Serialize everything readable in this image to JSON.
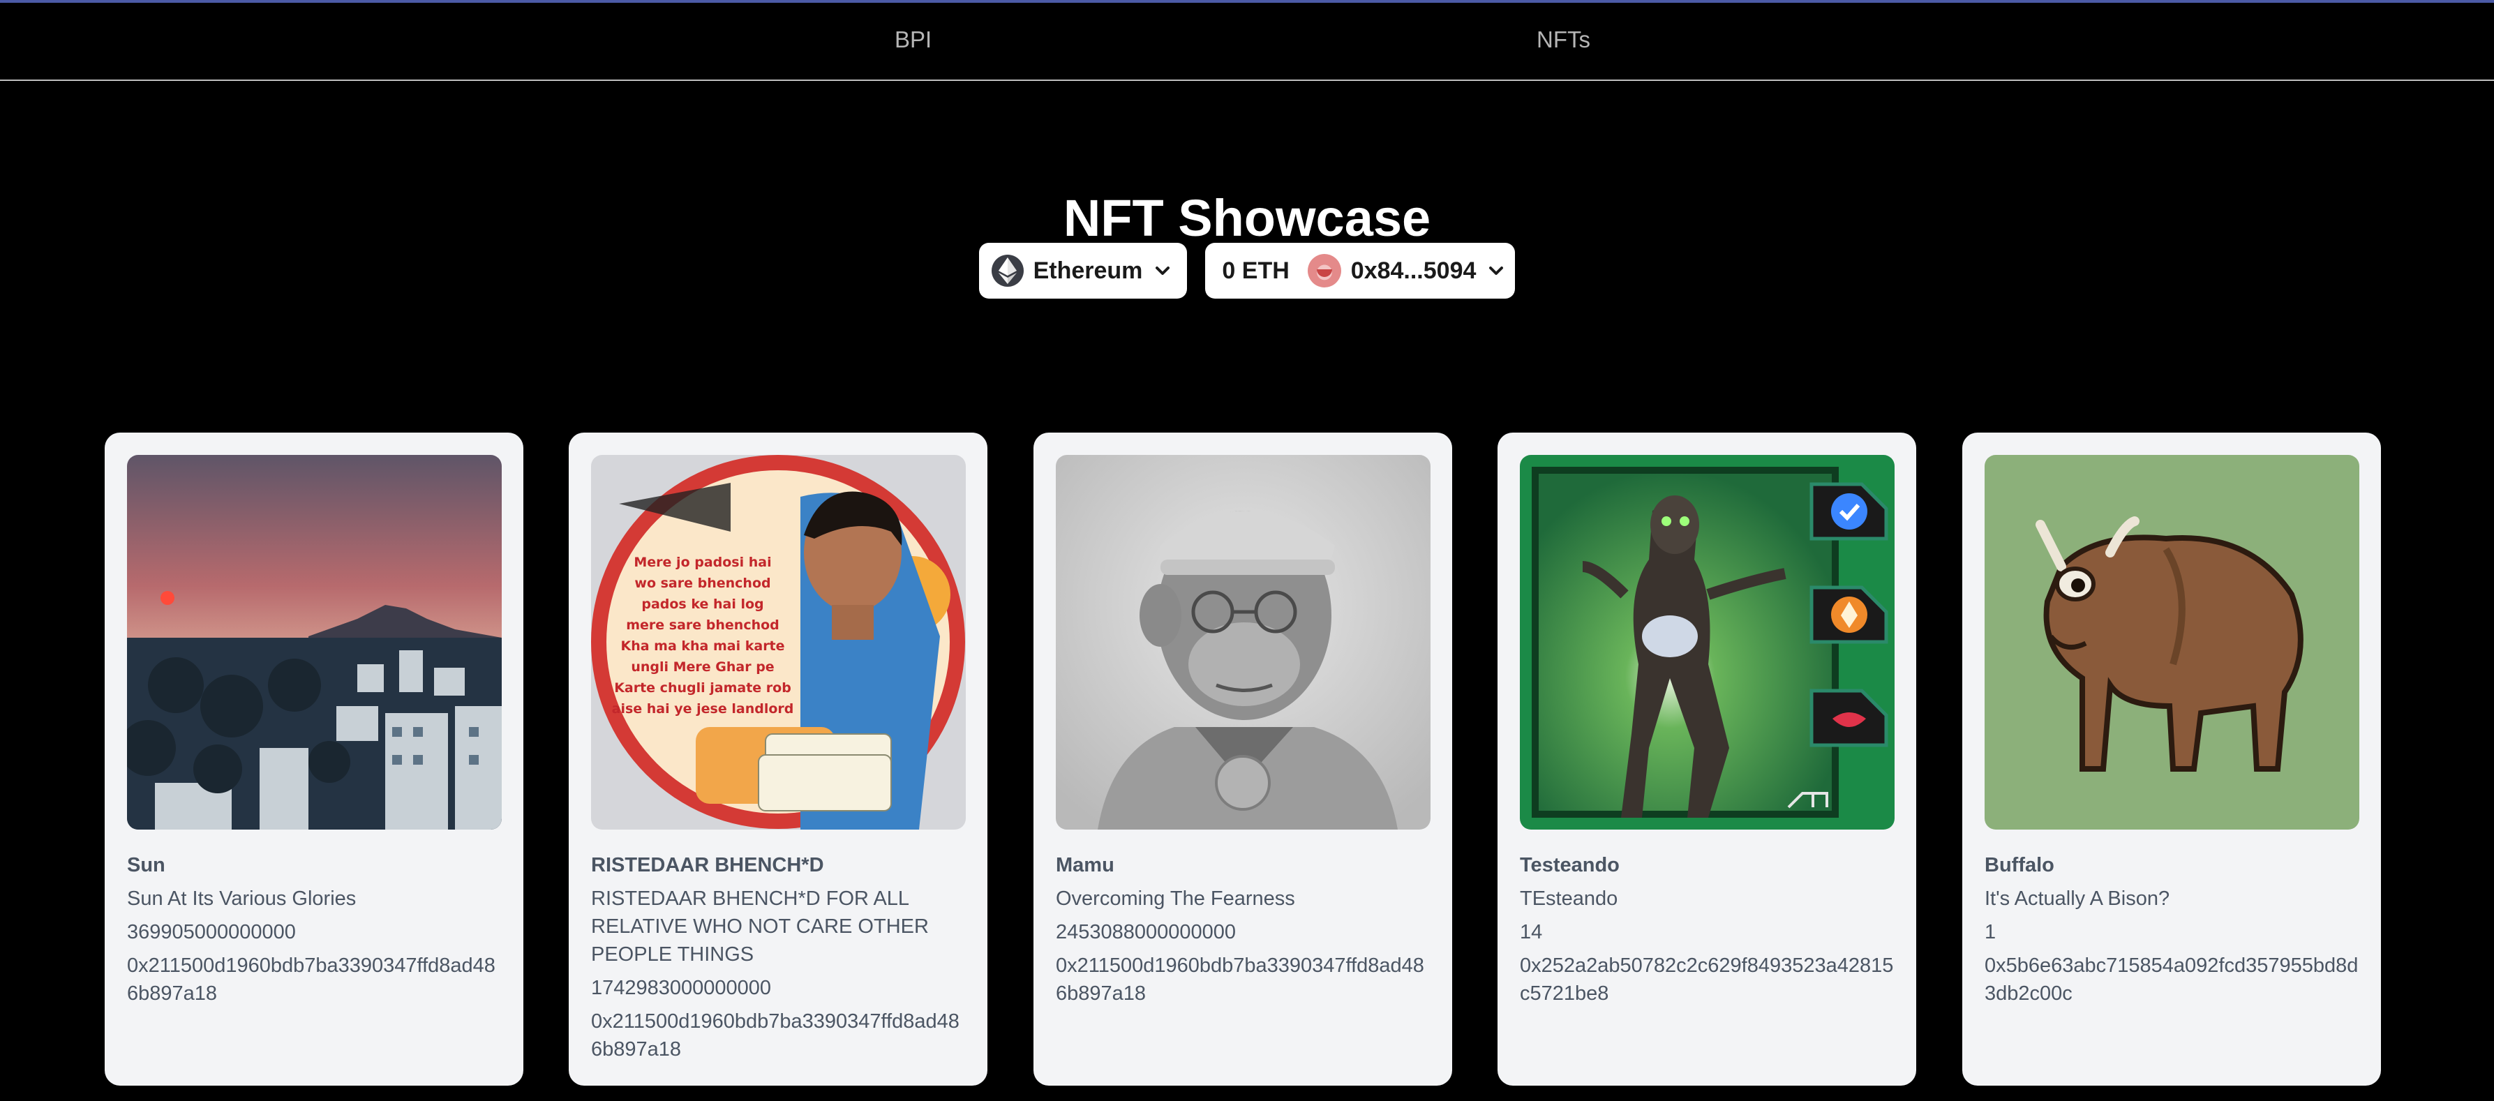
{
  "nav": {
    "links": [
      {
        "label": "BPI"
      },
      {
        "label": "NFTs"
      }
    ]
  },
  "page": {
    "title": "NFT Showcase"
  },
  "wallet": {
    "chain_label": "Ethereum",
    "balance": "0 ETH",
    "address": "0x84...5094"
  },
  "nfts": [
    {
      "name": "Sun",
      "description": "Sun At Its Various Glories",
      "token_id": "369905000000000",
      "contract": "0x211500d1960bdb7ba3390347ffd8ad486b897a18"
    },
    {
      "name": "RISTEDAAR BHENCH*D",
      "description": "RISTEDAAR BHENCH*D FOR ALL RELATIVE WHO NOT CARE OTHER PEOPLE THINGS",
      "token_id": "1742983000000000",
      "contract": "0x211500d1960bdb7ba3390347ffd8ad486b897a18",
      "image_text": [
        "Mere jo padosi hai",
        "wo sare bhenchod",
        "pados ke hai log",
        "mere sare bhenchod",
        "Kha ma kha mai karte",
        "ungli Mere Ghar pe",
        "Karte chugli  jamate rob",
        "aise hai ye jese landlord"
      ]
    },
    {
      "name": "Mamu",
      "description": "Overcoming The Fearness",
      "token_id": "2453088000000000",
      "contract": "0x211500d1960bdb7ba3390347ffd8ad486b897a18"
    },
    {
      "name": "Testeando",
      "description": "TEsteando",
      "token_id": "14",
      "contract": "0x252a2ab50782c2c629f8493523a42815c5721be8"
    },
    {
      "name": "Buffalo",
      "description": "It's Actually A Bison?",
      "token_id": "1",
      "contract": "0x5b6e63abc715854a092fcd357955bd8d3db2c00c"
    }
  ],
  "colors": {
    "background": "#000000",
    "card": "#f3f4f6",
    "card_text": "#4b5563",
    "nav_text": "#b5b5b5",
    "accent_bar": "#4b5aa6"
  },
  "icons": [
    "ethereum-icon",
    "chevron-down-icon",
    "account-avatar"
  ]
}
